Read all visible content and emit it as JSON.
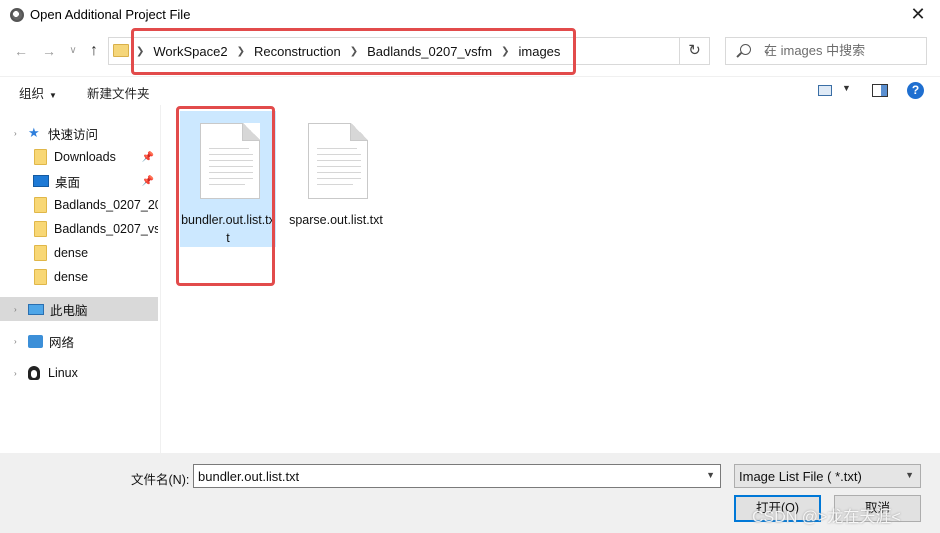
{
  "window": {
    "title": "Open Additional Project File",
    "close_glyph": "✕"
  },
  "nav": {
    "back": "←",
    "forward": "→",
    "recent": "∨",
    "up": "↑",
    "refresh": "↻"
  },
  "address": {
    "crumbs": [
      "WorkSpace2",
      "Reconstruction",
      "Badlands_0207_vsfm",
      "images"
    ],
    "dropdown": "⌄"
  },
  "search": {
    "placeholder": "在 images 中搜索"
  },
  "toolbar": {
    "organize": "组织",
    "new_folder": "新建文件夹",
    "help": "?"
  },
  "sidebar": {
    "quick_access": "快速访问",
    "items": [
      {
        "label": "Downloads",
        "icon": "folder-icon",
        "pinned": true
      },
      {
        "label": "桌面",
        "icon": "desktop-icon",
        "pinned": true
      },
      {
        "label": "Badlands_0207_20",
        "icon": "folder-icon",
        "pinned": false
      },
      {
        "label": "Badlands_0207_vs",
        "icon": "folder-icon",
        "pinned": false
      },
      {
        "label": "dense",
        "icon": "folder-icon",
        "pinned": false
      },
      {
        "label": "dense",
        "icon": "folder-icon",
        "pinned": false
      }
    ],
    "this_pc": "此电脑",
    "network": "网络",
    "linux": "Linux"
  },
  "files": [
    {
      "name": "bundler.out.list.txt",
      "selected": true
    },
    {
      "name": "sparse.out.list.txt",
      "selected": false
    }
  ],
  "bottom": {
    "filename_label": "文件名(N):",
    "filename_value": "bundler.out.list.txt",
    "filetype_value": "Image List File ( *.txt)",
    "open_label": "打开(O)",
    "cancel_label": "取消",
    "watermark": "CSDN @>龙在天涯<"
  },
  "colors": {
    "accent": "#0078d7",
    "selection": "#cce8ff",
    "annotation": "#e24b4b"
  }
}
